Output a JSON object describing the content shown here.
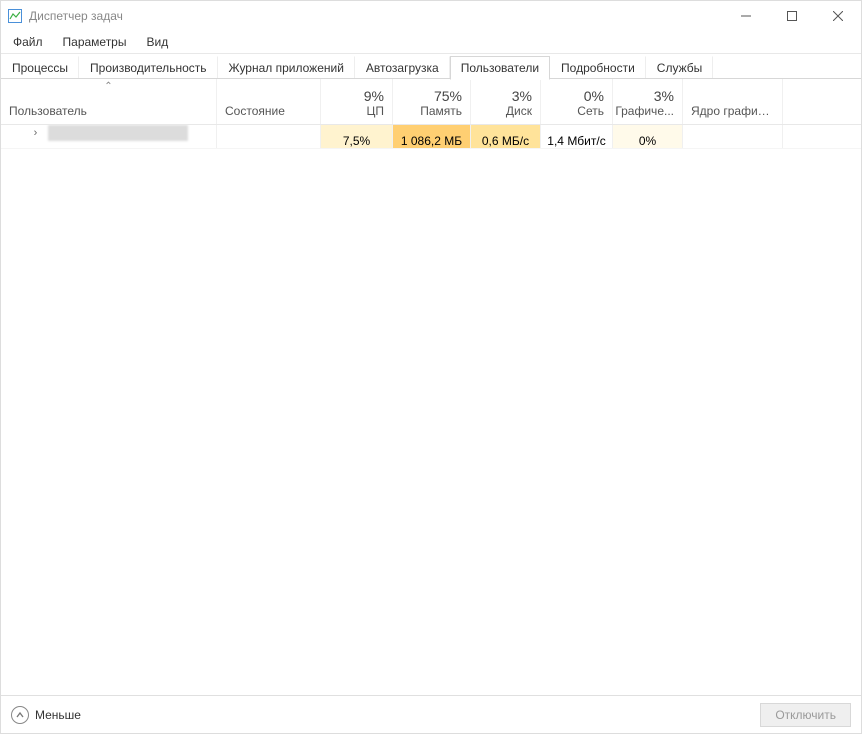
{
  "window": {
    "title": "Диспетчер задач"
  },
  "menu": {
    "file": "Файл",
    "options": "Параметры",
    "view": "Вид"
  },
  "tabs": {
    "processes": "Процессы",
    "performance": "Производительность",
    "app_history": "Журнал приложений",
    "startup": "Автозагрузка",
    "users": "Пользователи",
    "details": "Подробности",
    "services": "Службы",
    "active": "users"
  },
  "columns": {
    "user": "Пользователь",
    "status": "Состояние",
    "cpu_pct": "9%",
    "cpu_label": "ЦП",
    "mem_pct": "75%",
    "mem_label": "Память",
    "disk_pct": "3%",
    "disk_label": "Диск",
    "net_pct": "0%",
    "net_label": "Сеть",
    "gpu_pct": "3%",
    "gpu_label": "Графиче...",
    "engine_label": "Ядро графиче..."
  },
  "rows": [
    {
      "status": "",
      "cpu": "7,5%",
      "memory": "1 086,2 МБ",
      "disk": "0,6 МБ/с",
      "network": "1,4 Мбит/с",
      "gpu": "0%",
      "engine": ""
    }
  ],
  "footer": {
    "fewer": "Меньше",
    "disconnect": "Отключить"
  }
}
